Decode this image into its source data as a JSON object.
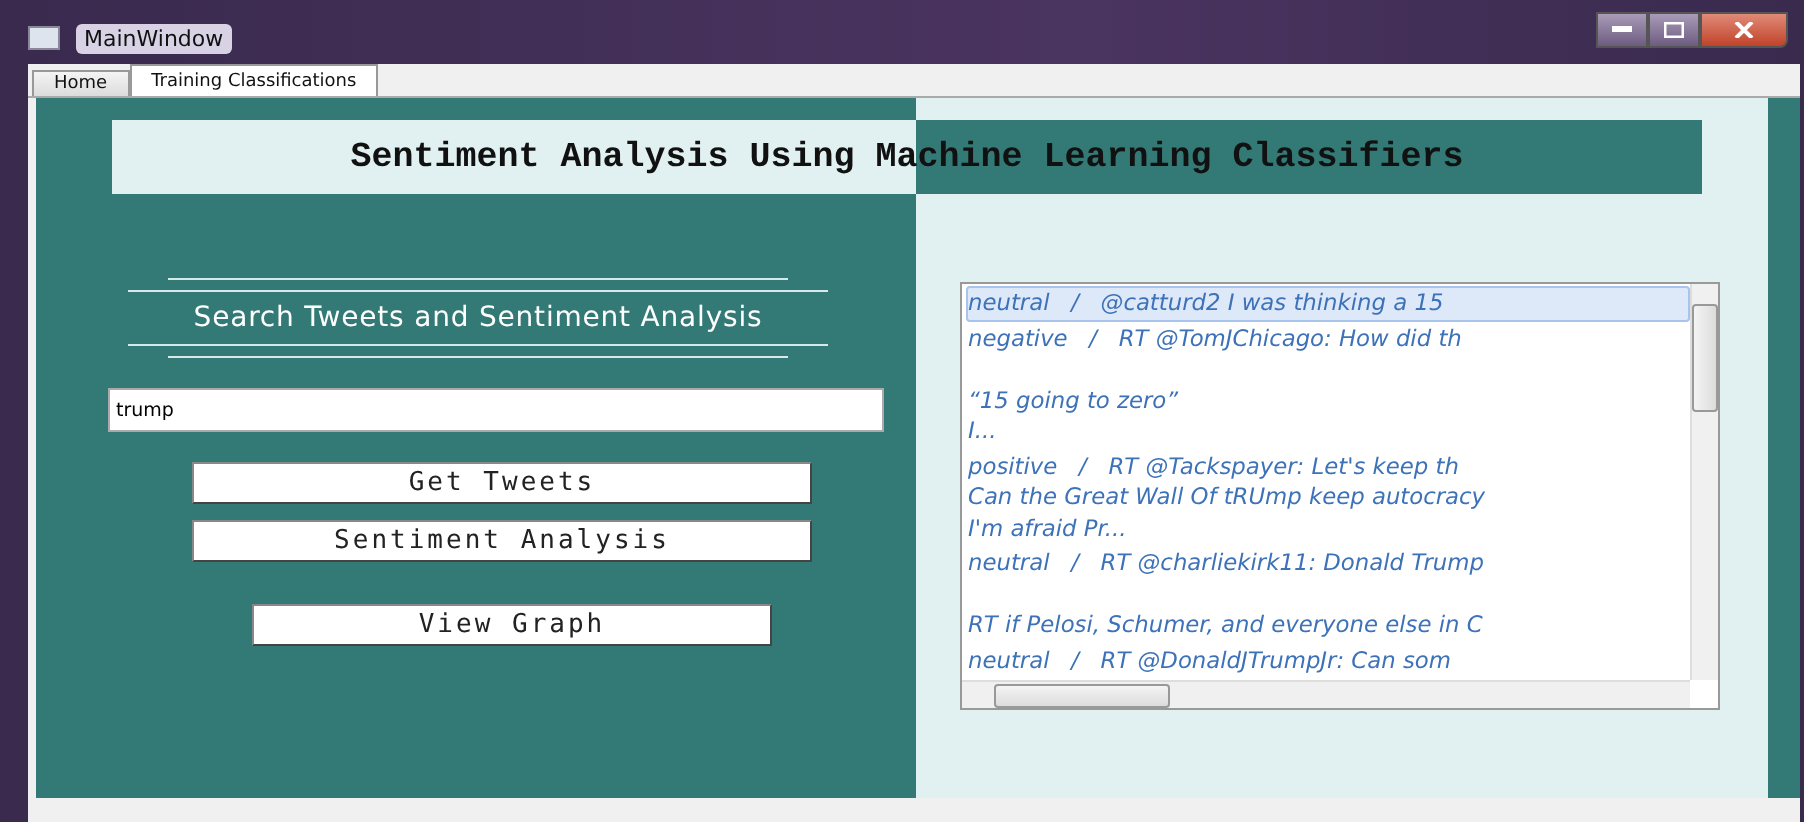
{
  "window": {
    "title": "MainWindow"
  },
  "tabs": [
    {
      "label": "Home",
      "selected": false
    },
    {
      "label": "Training Classifications",
      "selected": true
    }
  ],
  "banner": {
    "title": "Sentiment Analysis Using Machine Learning Classifiers"
  },
  "search_section": {
    "heading": "Search Tweets and Sentiment Analysis",
    "query": "trump"
  },
  "buttons": [
    "Get Tweets",
    "Sentiment Analysis",
    "View Graph"
  ],
  "results": [
    {
      "selected": true,
      "blank_line": false,
      "lines": [
        "neutral   /   @catturd2 I was thinking a 15"
      ]
    },
    {
      "selected": false,
      "blank_line": true,
      "lines": [
        "negative   /   RT @TomJChicago: How did th",
        "“15 going to zero”",
        "I..."
      ]
    },
    {
      "selected": false,
      "blank_line": false,
      "lines": [
        "positive   /   RT @Tackspayer: Let's keep th",
        "Can the Great Wall Of tRUmp keep autocracy",
        "I'm afraid Pr..."
      ]
    },
    {
      "selected": false,
      "blank_line": true,
      "lines": [
        "neutral   /   RT @charliekirk11: Donald Trump",
        "RT if Pelosi, Schumer, and everyone else in C"
      ]
    },
    {
      "selected": false,
      "blank_line": false,
      "lines": [
        "neutral   /   RT @DonaldJTrumpJr: Can som"
      ]
    }
  ]
}
